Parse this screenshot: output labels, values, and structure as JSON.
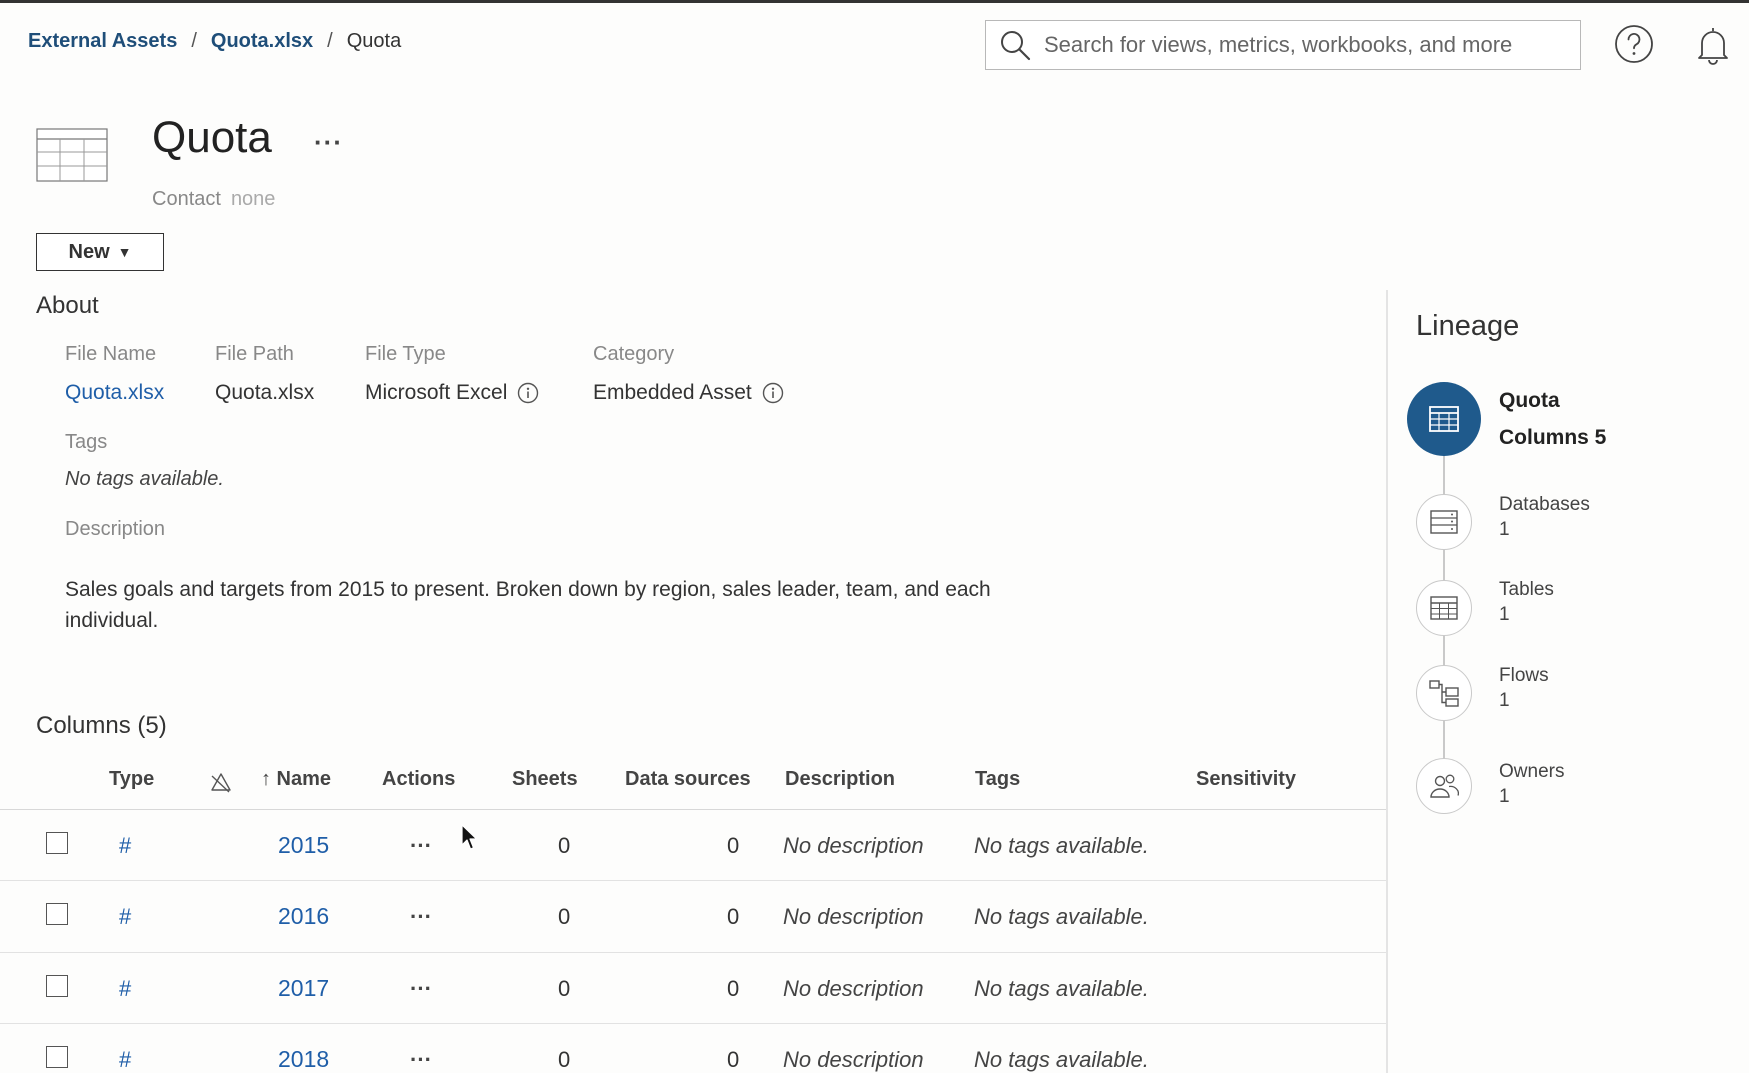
{
  "breadcrumb": {
    "root": "External Assets",
    "parent": "Quota.xlsx",
    "current": "Quota",
    "sep": "/"
  },
  "search": {
    "placeholder": "Search for views, metrics, workbooks, and more"
  },
  "asset": {
    "title": "Quota",
    "more": "···",
    "contact_label": "Contact",
    "contact_value": "none"
  },
  "new_button": {
    "label": "New",
    "caret": "▼"
  },
  "about": {
    "heading": "About",
    "file_name_label": "File Name",
    "file_name": "Quota.xlsx",
    "file_path_label": "File Path",
    "file_path": "Quota.xlsx",
    "file_type_label": "File Type",
    "file_type": "Microsoft Excel",
    "category_label": "Category",
    "category": "Embedded Asset",
    "tags_label": "Tags",
    "tags_value": "No tags available.",
    "description_label": "Description",
    "description": "Sales goals and targets from 2015 to present. Broken down by region, sales leader, team, and each individual."
  },
  "columns": {
    "heading": "Columns (5)",
    "headers": {
      "type": "Type",
      "name": "↑ Name",
      "actions": "Actions",
      "sheets": "Sheets",
      "data_sources": "Data sources",
      "description": "Description",
      "tags": "Tags",
      "sensitivity": "Sensitivity"
    },
    "rows": [
      {
        "type": "#",
        "name": "2015",
        "actions": "···",
        "sheets": "0",
        "data_sources": "0",
        "description": "No description",
        "tags": "No tags available."
      },
      {
        "type": "#",
        "name": "2016",
        "actions": "···",
        "sheets": "0",
        "data_sources": "0",
        "description": "No description",
        "tags": "No tags available."
      },
      {
        "type": "#",
        "name": "2017",
        "actions": "···",
        "sheets": "0",
        "data_sources": "0",
        "description": "No description",
        "tags": "No tags available."
      },
      {
        "type": "#",
        "name": "2018",
        "actions": "···",
        "sheets": "0",
        "data_sources": "0",
        "description": "No description",
        "tags": "No tags available."
      }
    ]
  },
  "lineage": {
    "heading": "Lineage",
    "main": {
      "title": "Quota",
      "subtitle": "Columns 5",
      "icon": "table-icon"
    },
    "items": [
      {
        "label": "Databases",
        "count": "1",
        "icon": "database-icon"
      },
      {
        "label": "Tables",
        "count": "1",
        "icon": "table-icon"
      },
      {
        "label": "Flows",
        "count": "1",
        "icon": "flow-icon"
      },
      {
        "label": "Owners",
        "count": "1",
        "icon": "owners-icon"
      }
    ]
  },
  "colors": {
    "link": "#1f5ea8",
    "breadcrumb_link": "#1f4e79",
    "lineage_main": "#1f5a8c"
  }
}
